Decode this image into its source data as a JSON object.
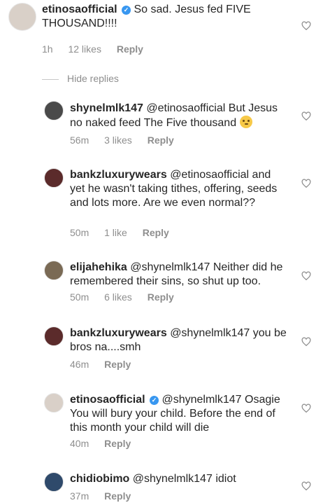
{
  "comments": [
    {
      "user": "etinosaofficial",
      "verified": true,
      "mention": "",
      "text": "So sad. Jesus fed FIVE THOUSAND!!!!",
      "time": "1h",
      "likes": "12 likes",
      "reply_label": "Reply"
    }
  ],
  "hide_replies_label": "Hide replies",
  "replies": [
    {
      "user": "shynelmlk147",
      "verified": false,
      "mention": "@etinosaofficial",
      "text": "But Jesus no naked feed The Five thousand",
      "emoji": "thinking-face",
      "time": "56m",
      "likes": "3 likes",
      "reply_label": "Reply"
    },
    {
      "user": "bankzluxurywears",
      "verified": false,
      "mention": "@etinosaofficial",
      "text": "and yet he wasn't taking tithes, offering, seeds and lots more. Are we even normal??",
      "time": "50m",
      "likes": "1 like",
      "reply_label": "Reply"
    },
    {
      "user": "elijahehika",
      "verified": false,
      "mention": "@shynelmlk147",
      "text": "Neither did he remembered their sins, so shut up too.",
      "time": "50m",
      "likes": "6 likes",
      "reply_label": "Reply"
    },
    {
      "user": "bankzluxurywears",
      "verified": false,
      "mention": "@shynelmlk147",
      "text": "you be bros na....smh",
      "time": "46m",
      "likes": "",
      "reply_label": "Reply"
    },
    {
      "user": "etinosaofficial",
      "verified": true,
      "mention": "@shynelmlk147",
      "text": "Osagie You will bury your child. Before the end of this month your child will die",
      "time": "40m",
      "likes": "",
      "reply_label": "Reply"
    },
    {
      "user": "chidiobimo",
      "verified": false,
      "mention": "@shynelmlk147",
      "text": "idiot",
      "time": "37m",
      "likes": "",
      "reply_label": "Reply"
    }
  ],
  "colors": {
    "text": "#262626",
    "meta": "#8e8e8e",
    "verified": "#3897f0"
  },
  "icons": {
    "like": "heart-outline-icon",
    "verified": "verified-badge-icon"
  }
}
